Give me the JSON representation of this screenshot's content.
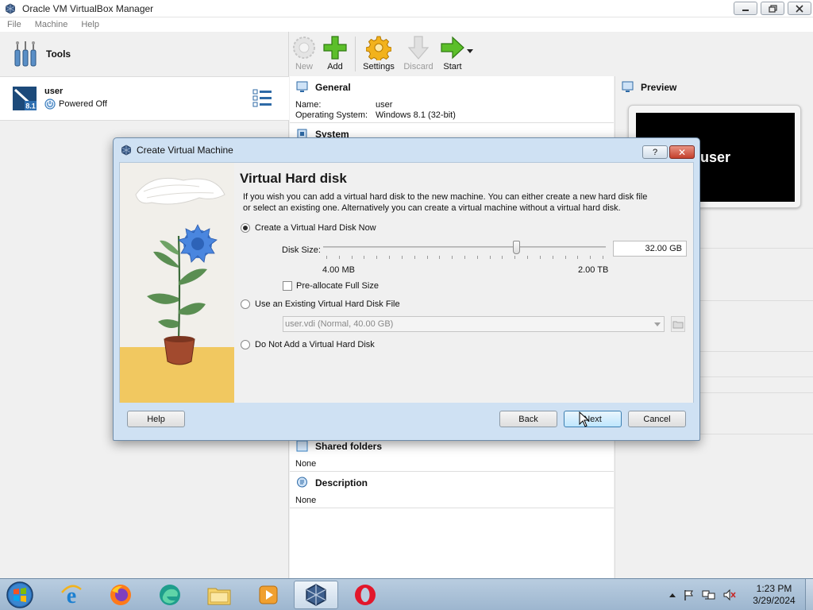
{
  "window": {
    "title": "Oracle VM VirtualBox Manager"
  },
  "menubar": {
    "items": [
      "File",
      "Machine",
      "Help"
    ]
  },
  "left": {
    "tools_label": "Tools",
    "vm": {
      "name": "user",
      "state": "Powered Off",
      "os_badge": "8.1"
    }
  },
  "toolbar": {
    "new": "New",
    "add": "Add",
    "settings": "Settings",
    "discard": "Discard",
    "start": "Start"
  },
  "details": {
    "general": {
      "title": "General",
      "name_key": "Name:",
      "name_val": "user",
      "os_key": "Operating System:",
      "os_val": "Windows 8.1 (32-bit)"
    },
    "system": {
      "title": "System"
    },
    "shared_folders": {
      "title": "Shared folders",
      "value": "None"
    },
    "description": {
      "title": "Description",
      "value": "None"
    }
  },
  "preview": {
    "title": "Preview",
    "screen_text": "user"
  },
  "dialog": {
    "title": "Create Virtual Machine",
    "help_glyph": "?",
    "close_glyph": "✕",
    "heading": "Virtual Hard disk",
    "description": "If you wish you can add a virtual hard disk to the new machine. You can either create a new hard disk file or select an existing one. Alternatively you can create a virtual machine without a virtual hard disk.",
    "option_create": "Create a Virtual Hard Disk Now",
    "disk_size_label": "Disk Size:",
    "disk_size_value": "32.00 GB",
    "disk_size_fraction": 0.69,
    "slider_min": "4.00 MB",
    "slider_max": "2.00 TB",
    "preallocate_label": "Pre-allocate Full Size",
    "option_existing": "Use an Existing Virtual Hard Disk File",
    "existing_file": "user.vdi (Normal, 40.00 GB)",
    "option_none": "Do Not Add a Virtual Hard Disk",
    "buttons": {
      "help": "Help",
      "back": "Back",
      "next": "Next",
      "cancel": "Cancel"
    }
  },
  "taskbar": {
    "time": "1:23 PM",
    "date": "3/29/2024"
  }
}
